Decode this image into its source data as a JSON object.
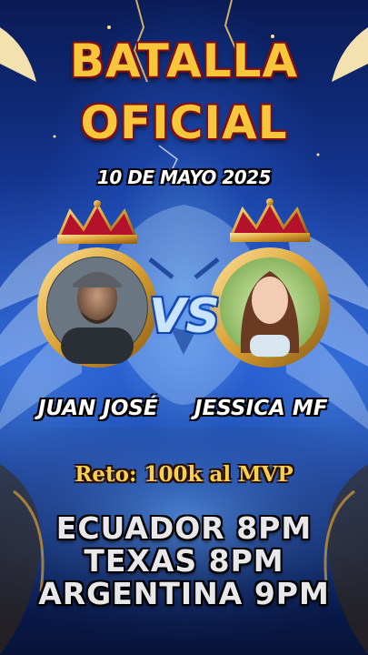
{
  "poster": {
    "title_line1": "BATALLA",
    "title_line2": "OFICIAL",
    "date": "10 DE MAYO 2025",
    "vs": "VS",
    "left_name": "JUAN JOSÉ",
    "right_name": "JESSICA MF",
    "challenge": "Reto: 100k al MVP",
    "schedule": [
      "ECUADOR  8PM",
      "TEXAS  8PM",
      "ARGENTINA  9PM"
    ]
  },
  "colors": {
    "title_gold": "#f7c63a",
    "title_outline": "#8a1010",
    "background_blue": "#1b4cc0",
    "frame_gold": "#d9a033",
    "crown_red": "#b4122a"
  },
  "icons": [
    "crown-icon",
    "lion-head",
    "angel-wing"
  ]
}
